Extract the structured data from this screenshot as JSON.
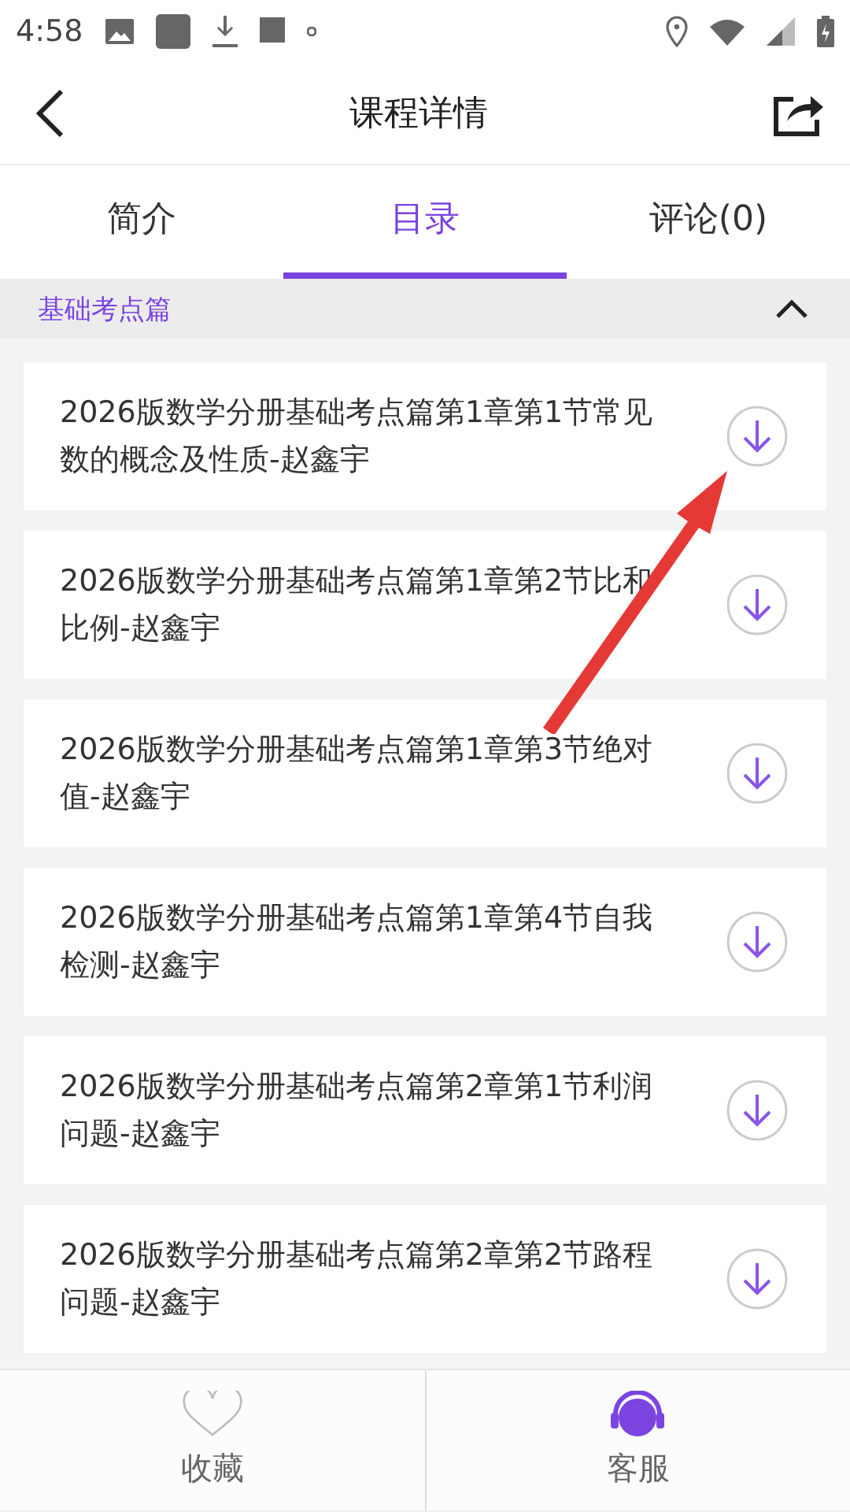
{
  "status_bar": {
    "time": "4:58"
  },
  "header": {
    "title": "课程详情"
  },
  "tabs": [
    {
      "label": "简介",
      "selected": false
    },
    {
      "label": "目录",
      "selected": true
    },
    {
      "label": "评论(0)",
      "selected": false
    }
  ],
  "section": {
    "title": "基础考点篇",
    "expanded": true
  },
  "lessons": [
    {
      "title": "2026版数学分册基础考点篇第1章第1节常见数的概念及性质-赵鑫宇"
    },
    {
      "title": "2026版数学分册基础考点篇第1章第2节比和比例-赵鑫宇"
    },
    {
      "title": "2026版数学分册基础考点篇第1章第3节绝对值-赵鑫宇"
    },
    {
      "title": "2026版数学分册基础考点篇第1章第4节自我检测-赵鑫宇"
    },
    {
      "title": "2026版数学分册基础考点篇第2章第1节利润问题-赵鑫宇"
    },
    {
      "title": "2026版数学分册基础考点篇第2章第2节路程问题-赵鑫宇"
    }
  ],
  "bottom_bar": [
    {
      "kind": "heart",
      "label": "收藏"
    },
    {
      "kind": "headset",
      "label": "客服"
    }
  ]
}
